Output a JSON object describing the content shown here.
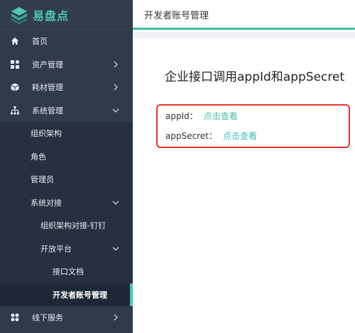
{
  "app": {
    "logo_text": "易盘点"
  },
  "sidebar": {
    "items": [
      {
        "label": "首页",
        "icon": "home-icon"
      },
      {
        "label": "资产管理",
        "icon": "asset-grid-icon"
      },
      {
        "label": "耗材管理",
        "icon": "box-icon"
      },
      {
        "label": "系统管理",
        "icon": "org-tree-icon"
      }
    ],
    "system_sub": [
      "组织架构",
      "角色",
      "管理员",
      "系统对接"
    ],
    "integration_sub": [
      "组织架构对接-钉钉",
      "开放平台"
    ],
    "platform_sub": [
      "接口文档",
      "开发者账号管理"
    ],
    "last": {
      "label": "线下服务",
      "icon": "service-icon"
    }
  },
  "header": {
    "title": "开发者账号管理"
  },
  "main": {
    "title": "企业接口调用appId和appSecret",
    "app_id_label": "appId：",
    "app_id_link": "点击查看",
    "app_secret_label": "appSecret：",
    "app_secret_link": "点击查看"
  },
  "colors": {
    "accent": "#3fbfaa",
    "sidebar": "#2f3a4c",
    "highlight_border": "#e8342a"
  }
}
